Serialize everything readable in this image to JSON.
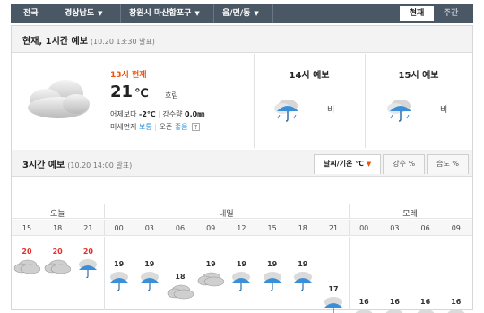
{
  "topbar": {
    "crumbs": [
      {
        "label": "전국",
        "dropdown": false
      },
      {
        "label": "경상남도",
        "dropdown": true
      },
      {
        "label": "창원시 마산합포구",
        "dropdown": true
      },
      {
        "label": "읍/면/동",
        "dropdown": true
      }
    ],
    "view_tabs": [
      {
        "label": "현재",
        "active": true
      },
      {
        "label": "주간",
        "active": false
      }
    ]
  },
  "current": {
    "title": "현재, 1시간 예보",
    "issued": "(10.20 13:30 발표)",
    "now_label": "13시 현재",
    "temp": "21",
    "temp_unit": "℃",
    "condition": "흐림",
    "diff_label": "어제보다",
    "diff_value": "-2℃",
    "precip_label": "강수량",
    "precip_value": "0.0㎜",
    "dust_label": "미세먼지",
    "dust_value": "보통",
    "ozone_label": "오존",
    "ozone_value": "좋음",
    "help": "?",
    "icon": "cloudy-icon",
    "hourly": [
      {
        "title": "14시 예보",
        "condition": "비",
        "icon": "rain-icon"
      },
      {
        "title": "15시 예보",
        "condition": "비",
        "icon": "rain-icon"
      }
    ]
  },
  "three_hour": {
    "title": "3시간 예보",
    "issued": "(10.20 14:00 발표)",
    "tabs": [
      {
        "label": "날씨/기온 ℃",
        "active": true
      },
      {
        "label": "강수 %",
        "active": false
      },
      {
        "label": "습도 %",
        "active": false
      }
    ],
    "days": [
      {
        "label": "오늘",
        "span": 3
      },
      {
        "label": "내일",
        "span": 8
      },
      {
        "label": "모레",
        "span": 4
      }
    ],
    "slots": [
      {
        "time": "15",
        "temp": 20,
        "icon": "cloudy-icon"
      },
      {
        "time": "18",
        "temp": 20,
        "icon": "cloudy-icon"
      },
      {
        "time": "21",
        "temp": 20,
        "icon": "rain-icon"
      },
      {
        "time": "00",
        "temp": 19,
        "icon": "rain-icon"
      },
      {
        "time": "03",
        "temp": 19,
        "icon": "rain-icon"
      },
      {
        "time": "06",
        "temp": 18,
        "icon": "cloudy-icon"
      },
      {
        "time": "09",
        "temp": 19,
        "icon": "cloudy-icon"
      },
      {
        "time": "12",
        "temp": 19,
        "icon": "rain-icon"
      },
      {
        "time": "15",
        "temp": 19,
        "icon": "rain-icon"
      },
      {
        "time": "18",
        "temp": 19,
        "icon": "rain-icon"
      },
      {
        "time": "21",
        "temp": 17,
        "icon": "rain-icon"
      },
      {
        "time": "00",
        "temp": 16,
        "icon": "rain-icon"
      },
      {
        "time": "03",
        "temp": 16,
        "icon": "rain-icon"
      },
      {
        "time": "06",
        "temp": 16,
        "icon": "rain-icon"
      },
      {
        "time": "09",
        "temp": 16,
        "icon": "rain-icon"
      }
    ]
  },
  "colors": {
    "topbar": "#4a5765",
    "accent": "#e9560f",
    "today_temp": "#e0322f",
    "temp": "#333333",
    "good": "#2a8fd6"
  }
}
